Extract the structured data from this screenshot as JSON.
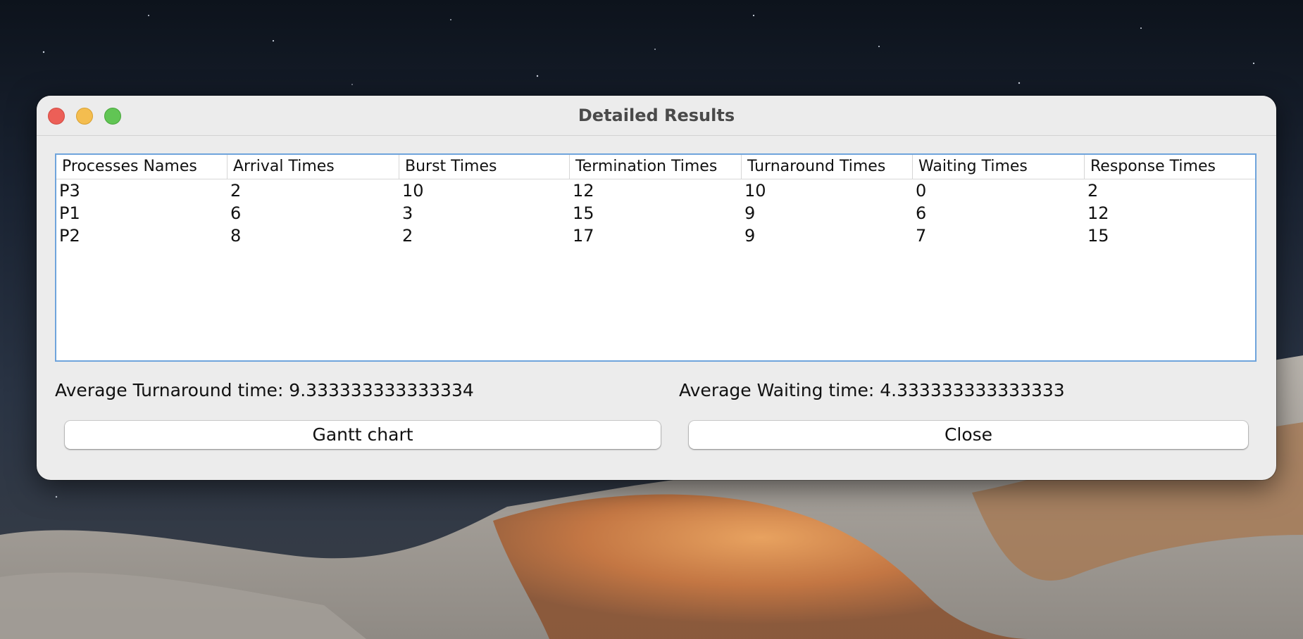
{
  "window": {
    "title": "Detailed Results"
  },
  "table": {
    "headers": [
      "Processes Names",
      "Arrival Times",
      "Burst Times",
      "Termination Times",
      "Turnaround Times",
      "Waiting Times",
      "Response Times"
    ],
    "rows": [
      [
        "P3",
        "2",
        "10",
        "12",
        "10",
        "0",
        "2"
      ],
      [
        "P1",
        "6",
        "3",
        "15",
        "9",
        "6",
        "12"
      ],
      [
        "P2",
        "8",
        "2",
        "17",
        "9",
        "7",
        "15"
      ]
    ]
  },
  "averages": {
    "turnaround": "Average Turnaround time: 9.333333333333334",
    "waiting": "Average Waiting time: 4.333333333333333"
  },
  "buttons": {
    "gantt_label": "Gantt chart",
    "close_label": "Close"
  },
  "colors": {
    "window_background": "#ececec",
    "table_focus_border": "#6fa4dc",
    "traffic_close": "#ec5f57",
    "traffic_minimize": "#f4bd4f",
    "traffic_zoom": "#61c554"
  }
}
